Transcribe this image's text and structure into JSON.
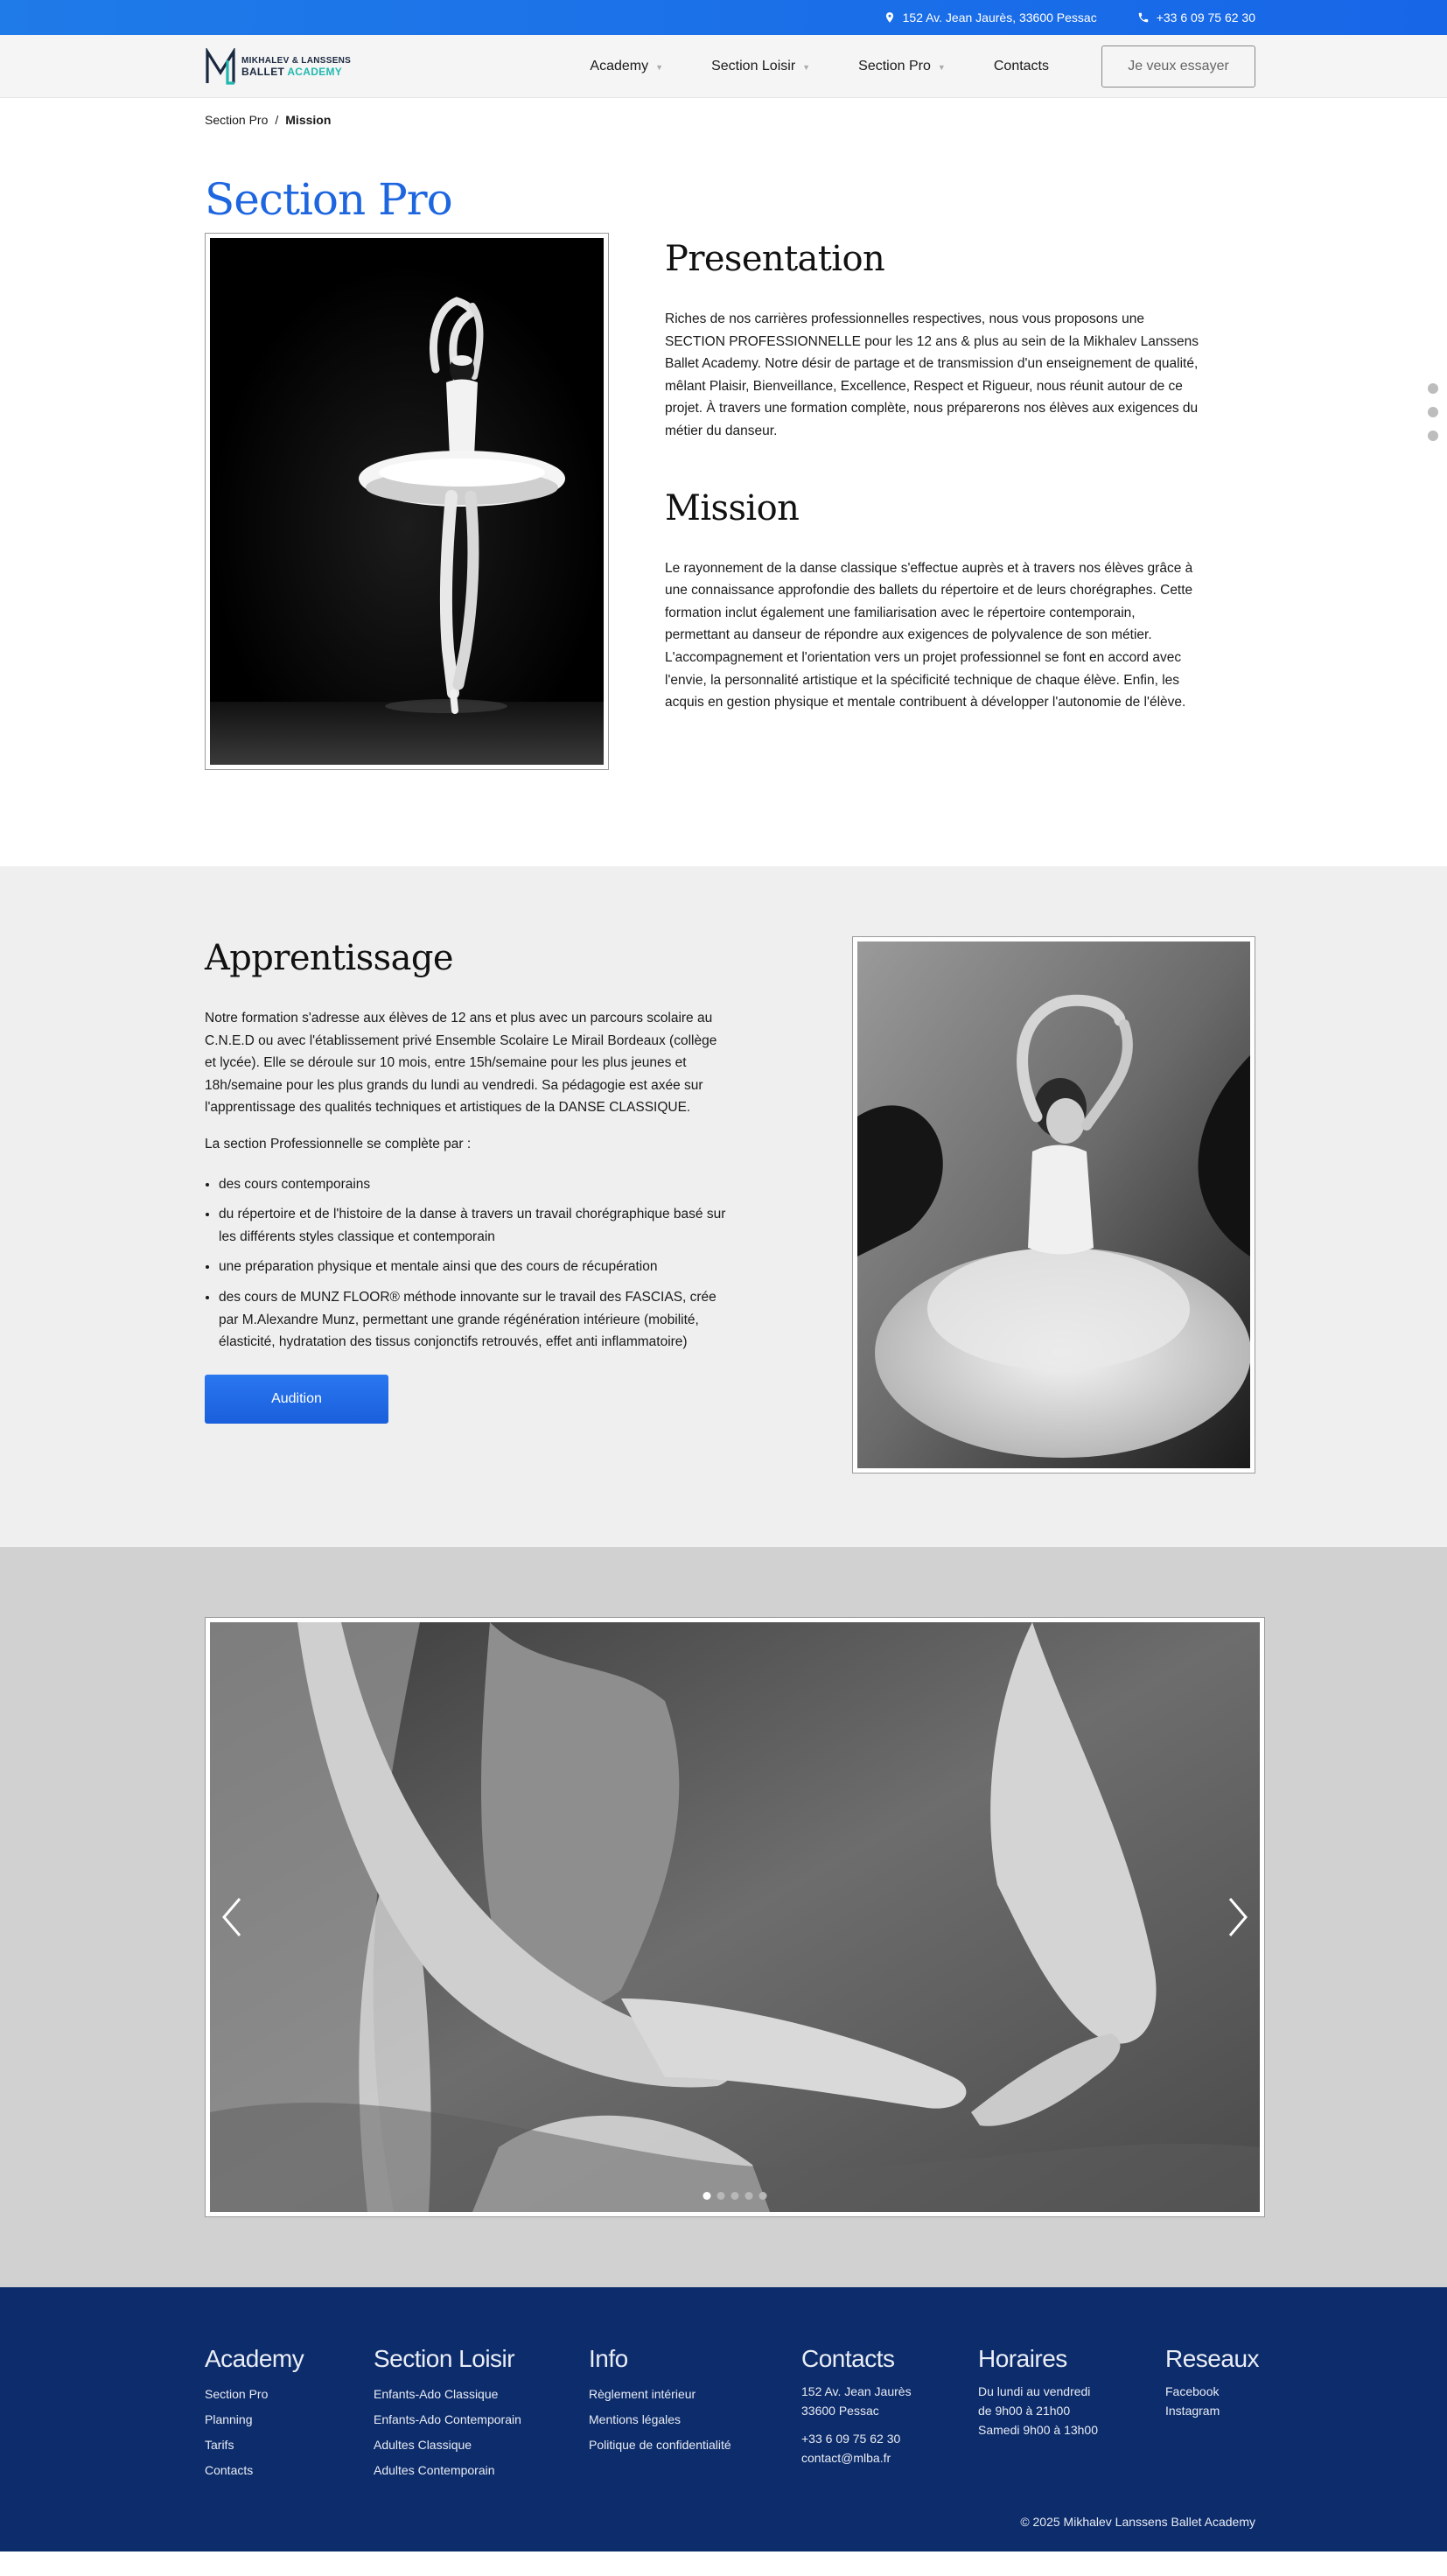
{
  "topbar": {
    "address": "152 Av. Jean Jaurès, 33600 Pessac",
    "phone": "+33 6 09 75 62 30"
  },
  "header": {
    "logo_line1": "MIKHALEV & LANSSENS",
    "logo_line2a": "BALLET",
    "logo_line2b": "ACADEMY",
    "nav": [
      {
        "label": "Academy"
      },
      {
        "label": "Section Loisir"
      },
      {
        "label": "Section Pro"
      },
      {
        "label": "Contacts"
      }
    ],
    "cta": "Je veux essayer"
  },
  "breadcrumb": {
    "parent": "Section Pro",
    "separator": "/",
    "current": "Mission"
  },
  "page_title": "Section Pro",
  "presentation": {
    "title": "Presentation",
    "text": "Riches de nos carrières professionnelles respectives, nous vous proposons une SECTION PROFESSIONNELLE pour les 12 ans & plus au sein de la Mikhalev Lanssens Ballet Academy. Notre désir de partage et de transmission d'un enseignement de qualité, mêlant Plaisir, Bienveillance, Excellence, Respect et Rigueur, nous réunit autour de ce projet. À travers une formation complète, nous préparerons nos élèves aux exigences du métier du danseur."
  },
  "mission": {
    "title": "Mission",
    "text": "Le rayonnement de la danse classique s'effectue auprès et à travers nos élèves grâce à une connaissance approfondie des ballets du répertoire et de leurs chorégraphes. Cette formation inclut également une familiarisation avec le répertoire contemporain, permettant au danseur de répondre aux exigences de polyvalence de son métier. L'accompagnement et l'orientation vers un projet professionnel se font en accord avec l'envie, la personnalité artistique et la spécificité technique de chaque élève. Enfin, les acquis en gestion physique et mentale contribuent à développer l'autonomie de l'élève."
  },
  "apprentissage": {
    "title": "Apprentissage",
    "text": "Notre formation s'adresse aux élèves de 12 ans et plus avec un parcours scolaire au C.N.E.D ou avec l'établissement privé Ensemble Scolaire Le Mirail Bordeaux (collège et lycée). Elle se déroule sur 10 mois, entre 15h/semaine pour les plus jeunes et 18h/semaine pour les plus grands du lundi au vendredi. Sa pédagogie est axée sur l'apprentissage des qualités techniques et artistiques de la DANSE CLASSIQUE.",
    "intro": "La section Professionnelle se complète par :",
    "items": [
      "des cours contemporains",
      "du répertoire et de l'histoire de la danse à travers un travail chorégraphique basé sur les différents styles classique et contemporain",
      "une préparation physique et mentale ainsi que des cours de récupération",
      "des cours de MUNZ FLOOR® méthode innovante sur le travail des FASCIAS, crée par M.Alexandre Munz, permettant une grande régénération intérieure (mobilité, élasticité, hydratation des tissus conjonctifs retrouvés, effet anti inflammatoire)"
    ],
    "button": "Audition"
  },
  "slider": {
    "slide_count": 5,
    "active_index": 0
  },
  "footer": {
    "academy": {
      "title": "Academy",
      "links": [
        "Section Pro",
        "Planning",
        "Tarifs",
        "Contacts"
      ]
    },
    "loisir": {
      "title": "Section Loisir",
      "links": [
        "Enfants-Ado Classique",
        "Enfants-Ado Contemporain",
        "Adultes Classique",
        "Adultes Contemporain"
      ]
    },
    "info": {
      "title": "Info",
      "links": [
        "Règlement intérieur",
        "Mentions légales",
        "Politique de confidentialité"
      ]
    },
    "contacts": {
      "title": "Contacts",
      "address1": "152 Av. Jean Jaurès",
      "address2": "33600 Pessac",
      "phone": "+33 6 09 75 62 30",
      "email": "contact@mlba.fr"
    },
    "horaires": {
      "title": "Horaires",
      "line1": "Du lundi au vendredi",
      "line2": "de 9h00 à 21h00",
      "line3": "Samedi 9h00 à 13h00"
    },
    "reseaux": {
      "title": "Reseaux",
      "links": [
        "Facebook",
        "Instagram"
      ]
    },
    "copyright": "© 2025 Mikhalev Lanssens Ballet Academy"
  },
  "colors": {
    "brand_blue": "#1e66e0",
    "footer_navy": "#0d2c6b",
    "teal": "#22b8b0"
  }
}
